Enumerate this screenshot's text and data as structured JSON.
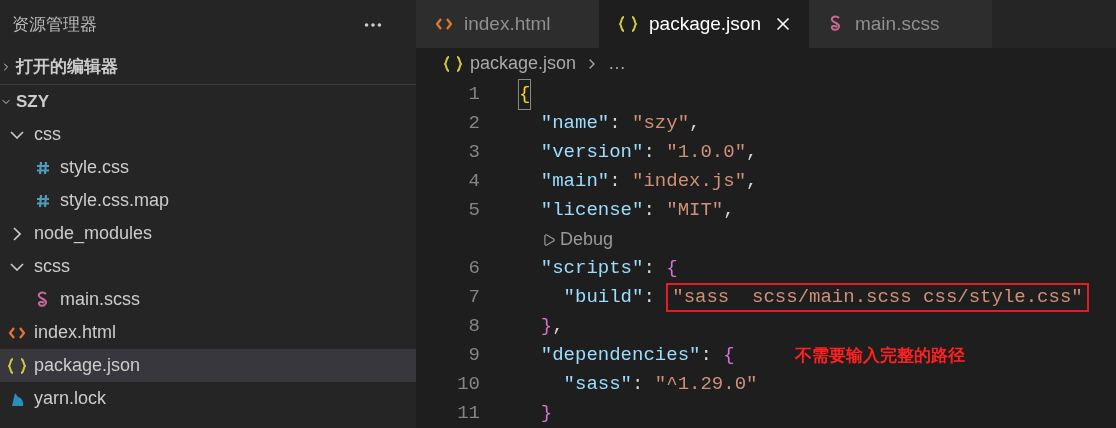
{
  "sidebar": {
    "title": "资源管理器",
    "sections": [
      {
        "label": "打开的编辑器",
        "expanded": false
      },
      {
        "label": "SZY",
        "expanded": true
      }
    ],
    "tree": [
      {
        "label": "css",
        "kind": "folder",
        "expanded": true,
        "selected": false,
        "children": [
          {
            "label": "style.css",
            "kind": "css",
            "selected": false
          },
          {
            "label": "style.css.map",
            "kind": "css",
            "selected": false
          }
        ]
      },
      {
        "label": "node_modules",
        "kind": "folder",
        "expanded": false,
        "selected": false
      },
      {
        "label": "scss",
        "kind": "folder",
        "expanded": true,
        "selected": false,
        "children": [
          {
            "label": "main.scss",
            "kind": "scss",
            "selected": false
          }
        ]
      },
      {
        "label": "index.html",
        "kind": "html",
        "selected": false
      },
      {
        "label": "package.json",
        "kind": "json",
        "selected": true
      },
      {
        "label": "yarn.lock",
        "kind": "yarn",
        "selected": false
      }
    ]
  },
  "tabs": [
    {
      "label": "index.html",
      "kind": "html",
      "selected": false
    },
    {
      "label": "package.json",
      "kind": "json",
      "selected": true
    },
    {
      "label": "main.scss",
      "kind": "scss",
      "selected": false
    }
  ],
  "breadcrumb": {
    "file": "package.json",
    "rest": "…"
  },
  "lines": [
    {
      "kind": "code",
      "number": "1",
      "tokens": [
        {
          "t": "{",
          "kind": "bracket1",
          "matched": true
        }
      ]
    },
    {
      "kind": "code",
      "number": "2",
      "tokens": [
        {
          "t": "  \"name\"",
          "kind": "key"
        },
        {
          "t": ": "
        },
        {
          "t": "\"szy\"",
          "kind": "string"
        },
        {
          "t": ","
        }
      ]
    },
    {
      "kind": "code",
      "number": "3",
      "tokens": [
        {
          "t": "  \"version\"",
          "kind": "key"
        },
        {
          "t": ": "
        },
        {
          "t": "\"1.0.0\"",
          "kind": "string"
        },
        {
          "t": ","
        }
      ]
    },
    {
      "kind": "code",
      "number": "4",
      "tokens": [
        {
          "t": "  \"main\"",
          "kind": "key"
        },
        {
          "t": ": "
        },
        {
          "t": "\"index.js\"",
          "kind": "string"
        },
        {
          "t": ","
        }
      ]
    },
    {
      "kind": "code",
      "number": "5",
      "tokens": [
        {
          "t": "  \"license\"",
          "kind": "key"
        },
        {
          "t": ": "
        },
        {
          "t": "\"MIT\"",
          "kind": "string"
        },
        {
          "t": ","
        }
      ]
    },
    {
      "kind": "codelens",
      "label": "Debug"
    },
    {
      "kind": "code",
      "number": "6",
      "tokens": [
        {
          "t": "  \"scripts\"",
          "kind": "key"
        },
        {
          "t": ": "
        },
        {
          "t": "{",
          "kind": "bracket2"
        }
      ]
    },
    {
      "kind": "code",
      "number": "7",
      "tokens": [
        {
          "t": "    \"build\"",
          "kind": "key"
        },
        {
          "t": ": "
        },
        {
          "t": "\"sass  scss/main.scss css/style.css\"",
          "kind": "string",
          "boxed": true
        }
      ]
    },
    {
      "kind": "code",
      "number": "8",
      "tokens": [
        {
          "t": "  }",
          "kind": "bracket2"
        },
        {
          "t": ","
        }
      ]
    },
    {
      "kind": "code",
      "number": "9",
      "tokens": [
        {
          "t": "  \"dependencies\"",
          "kind": "key"
        },
        {
          "t": ": "
        },
        {
          "t": "{",
          "kind": "bracket2"
        }
      ],
      "note": "不需要输入完整的路径"
    },
    {
      "kind": "code",
      "number": "10",
      "tokens": [
        {
          "t": "    \"sass\"",
          "kind": "key"
        },
        {
          "t": ": "
        },
        {
          "t": "\"^1.29.0\"",
          "kind": "string"
        }
      ]
    },
    {
      "kind": "code",
      "number": "11",
      "tokens": [
        {
          "t": "  }",
          "kind": "bracket2"
        }
      ]
    }
  ]
}
